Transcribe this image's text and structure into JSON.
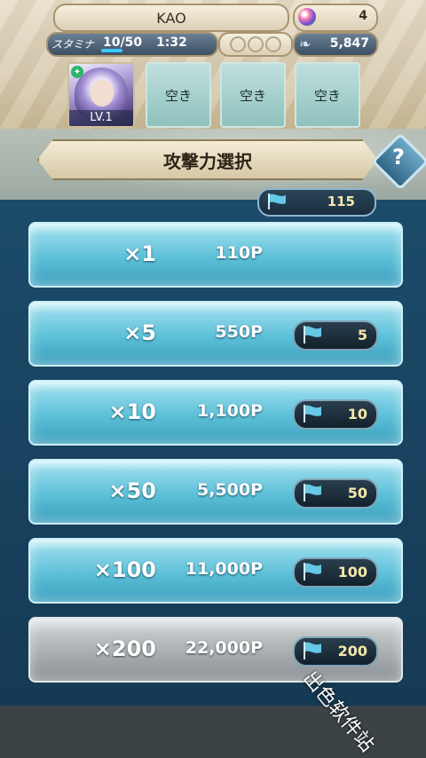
{
  "header": {
    "player_name": "KAO",
    "orb_count": "4",
    "stamina_label": "スタミナ",
    "stamina_value": "10/50",
    "stamina_fraction": 0.2,
    "stamina_timer": "1:32",
    "feather_count": "5,847",
    "hero_level": "LV.1",
    "empty_slots": [
      "空き",
      "空き",
      "空き"
    ]
  },
  "title": "攻撃力選択",
  "flag_total": "115",
  "options": [
    {
      "multiplier": "×1",
      "cost": "110P",
      "flags": ""
    },
    {
      "multiplier": "×5",
      "cost": "550P",
      "flags": "5"
    },
    {
      "multiplier": "×10",
      "cost": "1,100P",
      "flags": "10"
    },
    {
      "multiplier": "×50",
      "cost": "5,500P",
      "flags": "50"
    },
    {
      "multiplier": "×100",
      "cost": "11,000P",
      "flags": "100"
    },
    {
      "multiplier": "×200",
      "cost": "22,000P",
      "flags": "200"
    }
  ],
  "watermark": "出色软件站",
  "colors": {
    "accent": "#5cc0d8",
    "flag": "#66c7e6",
    "value": "#f3e8a8"
  }
}
